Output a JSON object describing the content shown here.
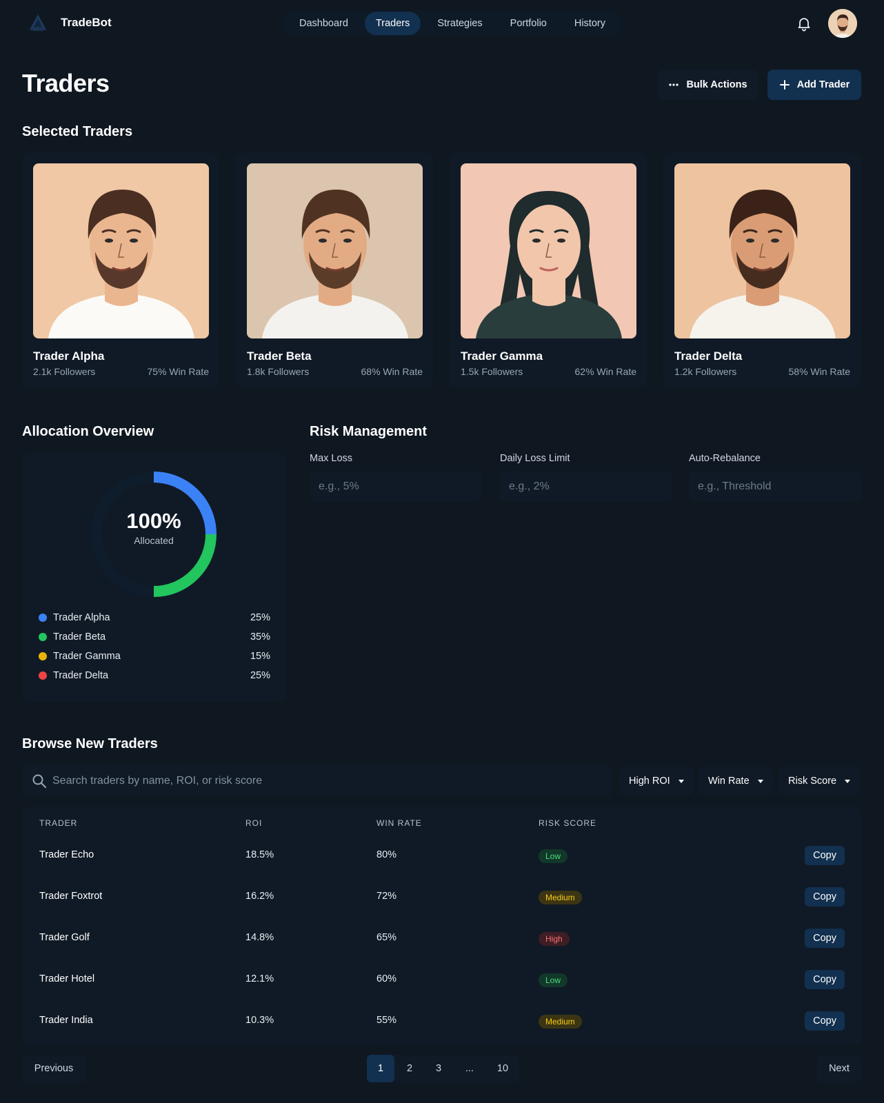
{
  "app": {
    "name": "TradeBot"
  },
  "nav": {
    "items": [
      "Dashboard",
      "Traders",
      "Strategies",
      "Portfolio",
      "History"
    ],
    "active": "Traders"
  },
  "header": {
    "title": "Traders",
    "bulk_label": "Bulk Actions",
    "add_label": "Add Trader"
  },
  "selected": {
    "title": "Selected Traders",
    "traders": [
      {
        "name": "Trader Alpha",
        "followers": "2.1k Followers",
        "win_rate": "75% Win Rate",
        "bg": "#f0c8a5",
        "skin": "#eab690",
        "hair": "#4a2e22",
        "shirt": "#fbfaf6"
      },
      {
        "name": "Trader Beta",
        "followers": "1.8k Followers",
        "win_rate": "68% Win Rate",
        "bg": "#dcc5ae",
        "skin": "#e2ab84",
        "hair": "#4f3222",
        "shirt": "#f3f2ee"
      },
      {
        "name": "Trader Gamma",
        "followers": "1.5k Followers",
        "win_rate": "62% Win Rate",
        "bg": "#f2c7b4",
        "skin": "#f1c6ab",
        "hair": "#1f2b2c",
        "shirt": "#2a3d3d"
      },
      {
        "name": "Trader Delta",
        "followers": "1.2k Followers",
        "win_rate": "58% Win Rate",
        "bg": "#eec3a0",
        "skin": "#d99c74",
        "hair": "#3a2218",
        "shirt": "#f5f3ec"
      }
    ]
  },
  "allocation": {
    "title": "Allocation Overview",
    "total": "100%",
    "total_label": "Allocated",
    "items": [
      {
        "name": "Trader Alpha",
        "pct": "25%",
        "color": "#3b82f6"
      },
      {
        "name": "Trader Beta",
        "pct": "35%",
        "color": "#22c55e"
      },
      {
        "name": "Trader Gamma",
        "pct": "15%",
        "color": "#eab308"
      },
      {
        "name": "Trader Delta",
        "pct": "25%",
        "color": "#ef4444"
      }
    ]
  },
  "risk": {
    "title": "Risk Management",
    "fields": [
      {
        "label": "Max Loss",
        "placeholder": "e.g., 5%"
      },
      {
        "label": "Daily Loss Limit",
        "placeholder": "e.g., 2%"
      },
      {
        "label": "Auto-Rebalance",
        "placeholder": "e.g., Threshold"
      }
    ]
  },
  "browse": {
    "title": "Browse New Traders",
    "search_placeholder": "Search traders by name, ROI, or risk score",
    "filters": [
      "High ROI",
      "Win Rate",
      "Risk Score"
    ],
    "columns": [
      "TRADER",
      "ROI",
      "WIN RATE",
      "RISK SCORE"
    ],
    "copy_label": "Copy",
    "rows": [
      {
        "name": "Trader Echo",
        "roi": "18.5%",
        "win": "80%",
        "risk": "Low"
      },
      {
        "name": "Trader Foxtrot",
        "roi": "16.2%",
        "win": "72%",
        "risk": "Medium"
      },
      {
        "name": "Trader Golf",
        "roi": "14.8%",
        "win": "65%",
        "risk": "High"
      },
      {
        "name": "Trader Hotel",
        "roi": "12.1%",
        "win": "60%",
        "risk": "Low"
      },
      {
        "name": "Trader India",
        "roi": "10.3%",
        "win": "55%",
        "risk": "Medium"
      }
    ]
  },
  "pagination": {
    "prev": "Previous",
    "next": "Next",
    "pages": [
      "1",
      "2",
      "3",
      "...",
      "10"
    ],
    "current": "1"
  },
  "icons": {
    "logo": "triangle-logo-icon",
    "bell": "bell-icon",
    "more": "more-horizontal-icon",
    "plus": "plus-icon",
    "search": "search-icon",
    "caret": "chevron-down-icon"
  }
}
